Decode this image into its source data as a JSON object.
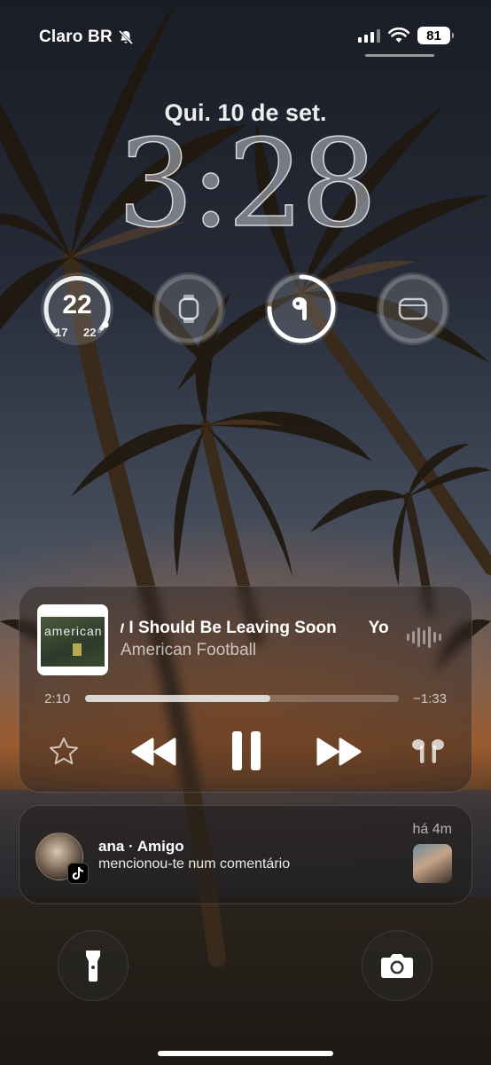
{
  "status_bar": {
    "carrier": "Claro BR",
    "battery_level": "81",
    "icons": [
      "bell-slash-icon",
      "signal-icon",
      "wifi-icon",
      "battery-icon"
    ]
  },
  "lock_screen": {
    "date": "Qui. 10 de set.",
    "time": "3:28"
  },
  "widgets": {
    "weather": {
      "temperature": "22",
      "low": "17",
      "high": "22"
    },
    "items": [
      "weather-gauge",
      "watch-battery-icon",
      "airpods-battery-icon",
      "airpods-case-battery-icon"
    ]
  },
  "now_playing": {
    "track_title": "How I Should Be Leaving Soon",
    "next_fragment": "Yo",
    "artist": "American Football",
    "album_cover_text": "american",
    "elapsed": "2:10",
    "remaining": "−1:33",
    "progress": 0.59,
    "controls": [
      "star-icon",
      "rewind-icon",
      "pause-icon",
      "fast-forward-icon",
      "airpods-icon"
    ]
  },
  "notification": {
    "title": "ana · Amigo",
    "body": "mencionou-te num comentário",
    "time": "há 4m",
    "app": "tiktok"
  },
  "quick_actions": [
    "flashlight-icon",
    "camera-icon"
  ]
}
